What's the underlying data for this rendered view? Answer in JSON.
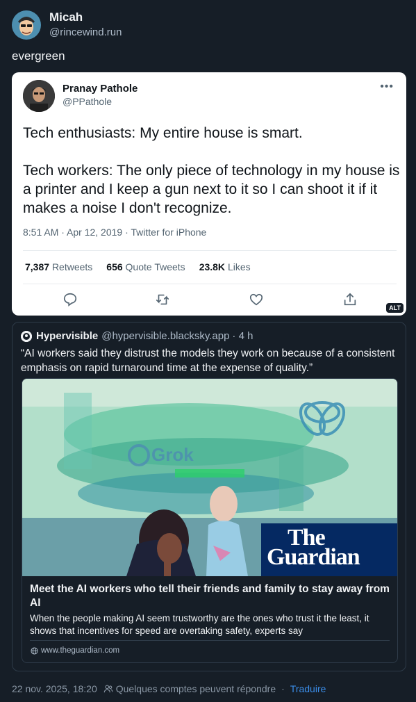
{
  "post": {
    "author_name": "Micah",
    "author_handle": "@rincewind.run",
    "text": "evergreen"
  },
  "embedded_tweet": {
    "author_name": "Pranay Pathole",
    "author_handle": "@PPathole",
    "more_icon": "•••",
    "body_p1": "Tech enthusiasts: My entire house is smart.",
    "body_p2": "Tech workers: The only piece of technology in my house is a printer and I keep a gun next to it so I can shoot it if it makes a noise I don't recognize.",
    "meta": "8:51 AM · Apr 12, 2019 · Twitter for iPhone",
    "stats": {
      "retweets_count": "7,387",
      "retweets_label": "Retweets",
      "quotes_count": "656",
      "quotes_label": "Quote Tweets",
      "likes_count": "23.8K",
      "likes_label": "Likes"
    },
    "alt_badge": "ALT"
  },
  "quoted_post": {
    "author_name": "Hypervisible",
    "author_handle": "@hypervisible.blacksky.app",
    "time": "· 4 h",
    "text": "“AI workers said they distrust the models they work on because of a consistent emphasis on rapid turnaround time at the expense of quality.”",
    "link_card": {
      "image_grok_text": "Grok",
      "publisher_line1": "The",
      "publisher_line2": "Guardian",
      "title": "Meet the AI workers who tell their friends and family to stay away from AI",
      "description": "When the people making AI seem trustworthy are the ones who trust it the least, it shows that incentives for speed are overtaking safety, experts say",
      "domain": "www.theguardian.com"
    }
  },
  "footer": {
    "timestamp": "22 nov. 2025, 18:20",
    "reply_settings": "Quelques comptes peuvent répondre",
    "separator": "·",
    "translate": "Traduire"
  },
  "colors": {
    "background": "#161e27",
    "accent": "#3b8eea",
    "guardian_blue": "#052962"
  }
}
